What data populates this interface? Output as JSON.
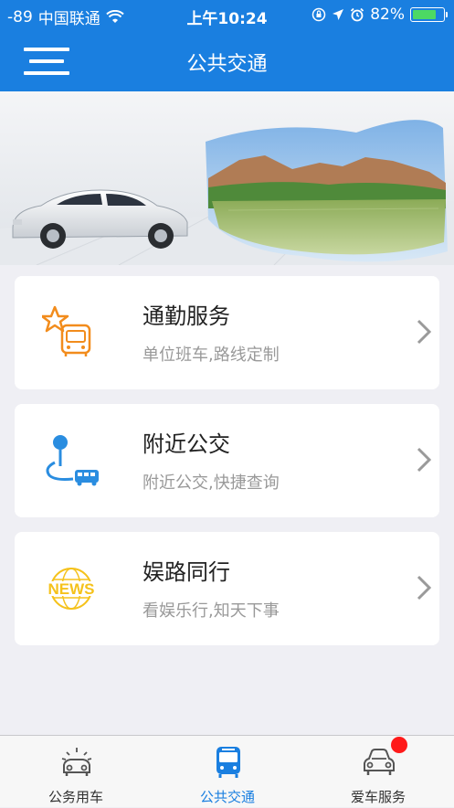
{
  "status_bar": {
    "signal": "-89",
    "carrier": "中国联通",
    "time": "上午10:24",
    "battery": "82%",
    "battery_level": 0.82
  },
  "nav": {
    "title": "公共交通"
  },
  "services": [
    {
      "title": "通勤服务",
      "subtitle": "单位班车,路线定制",
      "icon": "star-bus-icon"
    },
    {
      "title": "附近公交",
      "subtitle": "附近公交,快捷查询",
      "icon": "location-bus-icon"
    },
    {
      "title": "娱路同行",
      "subtitle": "看娱乐行,知天下事",
      "icon": "news-icon"
    }
  ],
  "news_icon_text": "NEWS",
  "tabs": [
    {
      "label": "公务用车",
      "icon": "official-car-icon",
      "active": false
    },
    {
      "label": "公共交通",
      "icon": "bus-icon",
      "active": true
    },
    {
      "label": "爱车服务",
      "icon": "car-service-icon",
      "active": false,
      "badge": true
    }
  ],
  "colors": {
    "primary": "#1a7fe0",
    "accent_orange": "#f28c1c",
    "news_yellow": "#f5c21b",
    "badge_red": "#ff1a1a"
  }
}
